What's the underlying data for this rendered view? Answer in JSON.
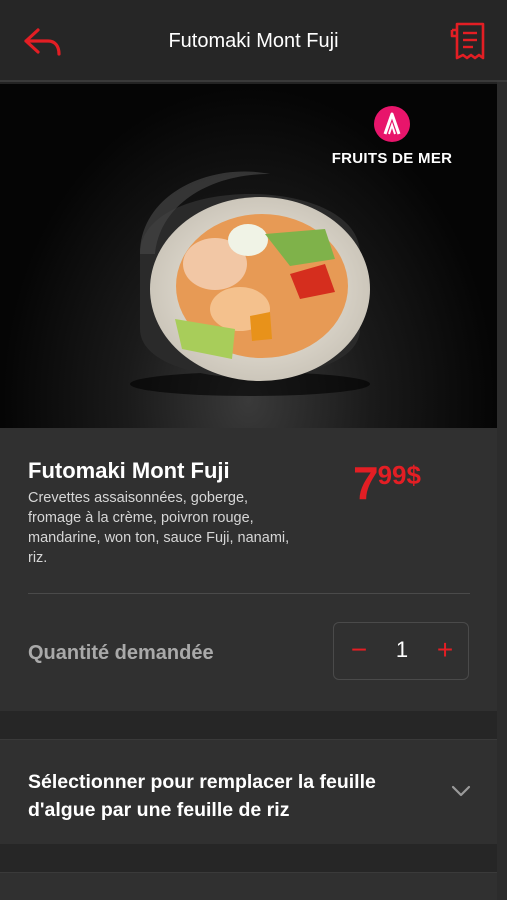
{
  "header": {
    "title": "Futomaki Mont Fuji",
    "back_icon": "back-arrow-icon",
    "receipt_icon": "receipt-icon"
  },
  "hero": {
    "badge": "FRUITS DE MER"
  },
  "product": {
    "name": "Futomaki Mont Fuji",
    "description": " Crevettes assaisonnées, goberge, fromage à la crème, poivron rouge, mandarine, won ton, sauce Fuji, nanami, riz.",
    "price_int": "7",
    "price_dec": "99$"
  },
  "quantity": {
    "label": "Quantité demandée",
    "value": "1",
    "minus": "−",
    "plus": "+"
  },
  "option": {
    "label": "Sélectionner pour remplacer la feuille d'algue par une feuille de riz"
  },
  "colors": {
    "accent": "#e31e24",
    "badge": "#e8156b",
    "background": "#232323",
    "card": "#303030"
  }
}
